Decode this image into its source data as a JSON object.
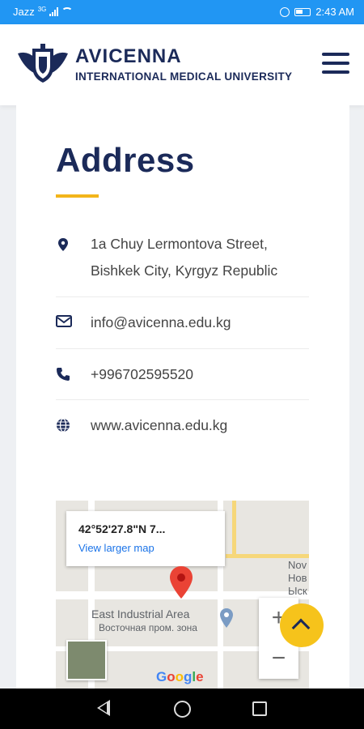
{
  "status_bar": {
    "carrier": "Jazz",
    "network": "3G",
    "time": "2:43 AM"
  },
  "header": {
    "brand_name": "AVICENNA",
    "brand_sub": "INTERNATIONAL MEDICAL UNIVERSITY",
    "menu_icon": "hamburger-menu-icon"
  },
  "section": {
    "title": "Address",
    "accent_color": "#f3b51b",
    "title_color": "#1b2a59"
  },
  "contact": {
    "address_line1": "1a Chuy Lermontova Street,",
    "address_line2": "Bishkek City, Kyrgyz Republic",
    "email": "info@avicenna.edu.kg",
    "phone": "+996702595520",
    "website": "www.avicenna.edu.kg"
  },
  "map": {
    "coords": "42°52'27.8\"N 7...",
    "larger_link": "View larger map",
    "area_label_en": "East Industrial Area",
    "area_label_ru": "Восточная пром. зона",
    "edge_label_1": "Nov",
    "edge_label_2": "Нов",
    "edge_label_3": "Ыск",
    "zoom_in": "+",
    "zoom_out": "−",
    "google": [
      "G",
      "o",
      "o",
      "g",
      "l",
      "e"
    ],
    "google_colors": [
      "#4285f4",
      "#ea4335",
      "#fbbc05",
      "#4285f4",
      "#34a853",
      "#ea4335"
    ]
  }
}
